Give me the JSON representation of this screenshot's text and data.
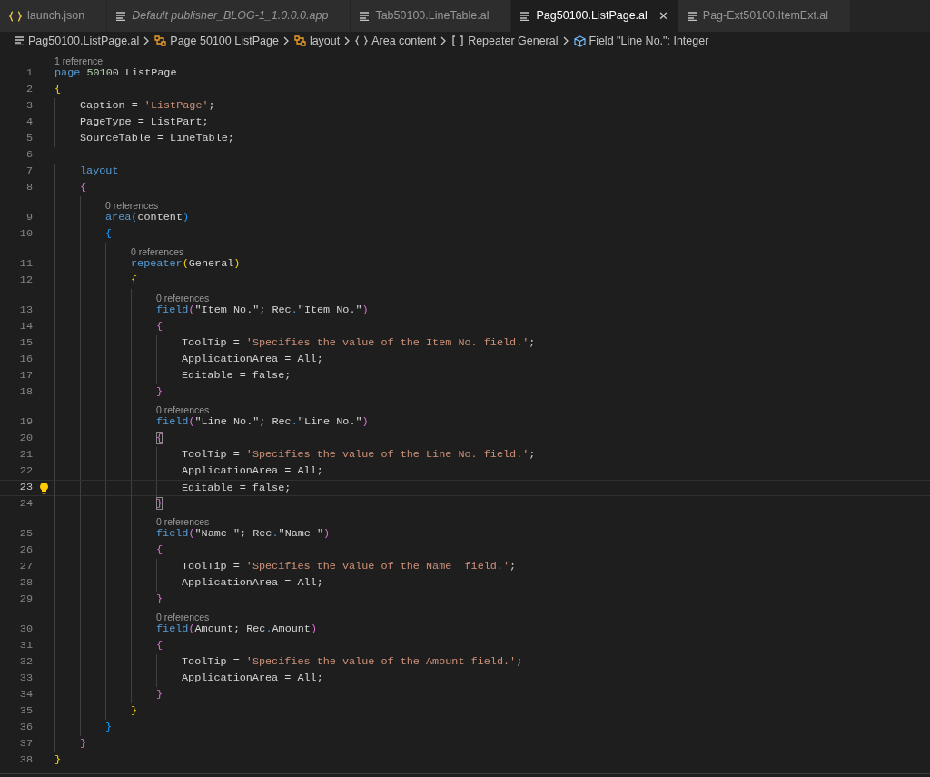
{
  "tabs": [
    {
      "label": "launch.json",
      "kind": "json",
      "selected": false,
      "italic": false
    },
    {
      "label": "Default publisher_BLOG-1_1.0.0.0.app",
      "kind": "file",
      "selected": false,
      "italic": true
    },
    {
      "label": "Tab50100.LineTable.al",
      "kind": "file",
      "selected": false,
      "italic": false
    },
    {
      "label": "Pag50100.ListPage.al",
      "kind": "file",
      "selected": true,
      "italic": false,
      "close": "✕"
    },
    {
      "label": "Pag-Ext50100.ItemExt.al",
      "kind": "file",
      "selected": false,
      "italic": false
    }
  ],
  "breadcrumbs": [
    {
      "label": "Pag50100.ListPage.al",
      "kind": "file"
    },
    {
      "label": "Page 50100 ListPage",
      "kind": "object"
    },
    {
      "label": "layout",
      "kind": "object"
    },
    {
      "label": "Area content",
      "kind": "braces"
    },
    {
      "label": "Repeater General",
      "kind": "brackets"
    },
    {
      "label": "Field \"Line No.\": Integer",
      "kind": "field"
    }
  ],
  "editor": {
    "lines": [
      {
        "n": "1",
        "lens": "1 reference",
        "current": false,
        "bulb": false,
        "tokens": [
          {
            "text": "page ",
            "kind": "keyword"
          },
          {
            "text": "50100",
            "kind": "number"
          },
          {
            "text": " ListPage"
          }
        ]
      },
      {
        "n": "2",
        "current": false,
        "bulb": false,
        "tokens": [
          {
            "text": "{",
            "kind": "bracket1"
          }
        ]
      },
      {
        "n": "3",
        "current": false,
        "bulb": false,
        "tokens": [
          {
            "text": "    Caption = "
          },
          {
            "text": "'ListPage'",
            "kind": "string"
          },
          {
            "text": ";"
          }
        ]
      },
      {
        "n": "4",
        "current": false,
        "bulb": false,
        "tokens": [
          {
            "text": "    PageType = ListPart;"
          }
        ]
      },
      {
        "n": "5",
        "current": false,
        "bulb": false,
        "tokens": [
          {
            "text": "    SourceTable = LineTable;"
          }
        ]
      },
      {
        "n": "6",
        "current": false,
        "bulb": false
      },
      {
        "n": "7",
        "current": false,
        "bulb": false,
        "tokens": [
          {
            "text": "    layout",
            "kind": "keyword"
          }
        ]
      },
      {
        "n": "8",
        "current": false,
        "bulb": false,
        "tokens": [
          {
            "text": "    {",
            "kind": "bracket2"
          }
        ]
      },
      {
        "n": "9",
        "lens": "0 references",
        "current": false,
        "bulb": false,
        "tokens": [
          {
            "text": "        area",
            "kind": "keyword"
          },
          {
            "text": "(",
            "kind": "bracket3"
          },
          {
            "text": "content"
          },
          {
            "text": ")",
            "kind": "bracket3"
          }
        ]
      },
      {
        "n": "10",
        "current": false,
        "bulb": false,
        "tokens": [
          {
            "text": "        {",
            "kind": "bracket3"
          }
        ]
      },
      {
        "n": "11",
        "lens": "0 references",
        "current": false,
        "bulb": false,
        "tokens": [
          {
            "text": "            repeater",
            "kind": "keyword"
          },
          {
            "text": "(",
            "kind": "bracket1"
          },
          {
            "text": "General"
          },
          {
            "text": ")",
            "kind": "bracket1"
          }
        ]
      },
      {
        "n": "12",
        "current": false,
        "bulb": false,
        "tokens": [
          {
            "text": "            {",
            "kind": "bracket1"
          }
        ]
      },
      {
        "n": "13",
        "lens": "0 references",
        "current": false,
        "bulb": false,
        "tokens": [
          {
            "text": "                field",
            "kind": "keyword"
          },
          {
            "text": "(",
            "kind": "bracket2"
          },
          {
            "text": "\"Item No.\"; Rec"
          },
          {
            "text": ".",
            "kind": "dot"
          },
          {
            "text": "\"Item No.\""
          },
          {
            "text": ")",
            "kind": "bracket2"
          }
        ]
      },
      {
        "n": "14",
        "current": false,
        "bulb": false,
        "tokens": [
          {
            "text": "                {",
            "kind": "bracket2"
          }
        ]
      },
      {
        "n": "15",
        "current": false,
        "bulb": false,
        "tokens": [
          {
            "text": "                    ToolTip = "
          },
          {
            "text": "'Specifies the value of the Item No. field.'",
            "kind": "string"
          },
          {
            "text": ";"
          }
        ]
      },
      {
        "n": "16",
        "current": false,
        "bulb": false,
        "tokens": [
          {
            "text": "                    ApplicationArea = All;"
          }
        ]
      },
      {
        "n": "17",
        "current": false,
        "bulb": false,
        "tokens": [
          {
            "text": "                    Editable = false;"
          }
        ]
      },
      {
        "n": "18",
        "current": false,
        "bulb": false,
        "tokens": [
          {
            "text": "                }",
            "kind": "bracket2"
          }
        ]
      },
      {
        "n": "19",
        "lens": "0 references",
        "current": false,
        "bulb": false,
        "tokens": [
          {
            "text": "                field",
            "kind": "keyword"
          },
          {
            "text": "(",
            "kind": "bracket2"
          },
          {
            "text": "\"Line No.\"; Rec"
          },
          {
            "text": ".",
            "kind": "dot"
          },
          {
            "text": "\"Line No.\""
          },
          {
            "text": ")",
            "kind": "bracket2"
          }
        ]
      },
      {
        "n": "20",
        "current": false,
        "bulb": false,
        "tokens": [
          {
            "text": "                {",
            "kind": "bracket2-matched"
          }
        ]
      },
      {
        "n": "21",
        "current": false,
        "bulb": false,
        "tokens": [
          {
            "text": "                    ToolTip = "
          },
          {
            "text": "'Specifies the value of the Line No. field.'",
            "kind": "string"
          },
          {
            "text": ";"
          }
        ]
      },
      {
        "n": "22",
        "current": false,
        "bulb": false,
        "tokens": [
          {
            "text": "                    ApplicationArea = All;"
          }
        ]
      },
      {
        "n": "23",
        "current": true,
        "bulb": true,
        "tokens": [
          {
            "text": "                    Editable = false;"
          }
        ]
      },
      {
        "n": "24",
        "current": false,
        "bulb": false,
        "tokens": [
          {
            "text": "                }",
            "kind": "bracket2-matched"
          }
        ]
      },
      {
        "n": "25",
        "lens": "0 references",
        "current": false,
        "bulb": false,
        "tokens": [
          {
            "text": "                field",
            "kind": "keyword"
          },
          {
            "text": "(",
            "kind": "bracket2"
          },
          {
            "text": "\"Name \"; Rec"
          },
          {
            "text": ".",
            "kind": "dot"
          },
          {
            "text": "\"Name \""
          },
          {
            "text": ")",
            "kind": "bracket2"
          }
        ]
      },
      {
        "n": "26",
        "current": false,
        "bulb": false,
        "tokens": [
          {
            "text": "                {",
            "kind": "bracket2"
          }
        ]
      },
      {
        "n": "27",
        "current": false,
        "bulb": false,
        "tokens": [
          {
            "text": "                    ToolTip = "
          },
          {
            "text": "'Specifies the value of the Name  field.'",
            "kind": "string"
          },
          {
            "text": ";"
          }
        ]
      },
      {
        "n": "28",
        "current": false,
        "bulb": false,
        "tokens": [
          {
            "text": "                    ApplicationArea = All;"
          }
        ]
      },
      {
        "n": "29",
        "current": false,
        "bulb": false,
        "tokens": [
          {
            "text": "                }",
            "kind": "bracket2"
          }
        ]
      },
      {
        "n": "30",
        "lens": "0 references",
        "current": false,
        "bulb": false,
        "tokens": [
          {
            "text": "                field",
            "kind": "keyword"
          },
          {
            "text": "(",
            "kind": "bracket2"
          },
          {
            "text": "Amount; Rec"
          },
          {
            "text": ".",
            "kind": "dot"
          },
          {
            "text": "Amount"
          },
          {
            "text": ")",
            "kind": "bracket2"
          }
        ]
      },
      {
        "n": "31",
        "current": false,
        "bulb": false,
        "tokens": [
          {
            "text": "                {",
            "kind": "bracket2"
          }
        ]
      },
      {
        "n": "32",
        "current": false,
        "bulb": false,
        "tokens": [
          {
            "text": "                    ToolTip = "
          },
          {
            "text": "'Specifies the value of the Amount field.'",
            "kind": "string"
          },
          {
            "text": ";"
          }
        ]
      },
      {
        "n": "33",
        "current": false,
        "bulb": false,
        "tokens": [
          {
            "text": "                    ApplicationArea = All;"
          }
        ]
      },
      {
        "n": "34",
        "current": false,
        "bulb": false,
        "tokens": [
          {
            "text": "                }",
            "kind": "bracket2"
          }
        ]
      },
      {
        "n": "35",
        "current": false,
        "bulb": false,
        "tokens": [
          {
            "text": "            }",
            "kind": "bracket1"
          }
        ]
      },
      {
        "n": "36",
        "current": false,
        "bulb": false,
        "tokens": [
          {
            "text": "        }",
            "kind": "bracket3"
          }
        ]
      },
      {
        "n": "37",
        "current": false,
        "bulb": false,
        "tokens": [
          {
            "text": "    }",
            "kind": "bracket2"
          }
        ]
      },
      {
        "n": "38",
        "current": false,
        "bulb": false,
        "tokens": [
          {
            "text": "}",
            "kind": "bracket1"
          }
        ]
      }
    ]
  }
}
